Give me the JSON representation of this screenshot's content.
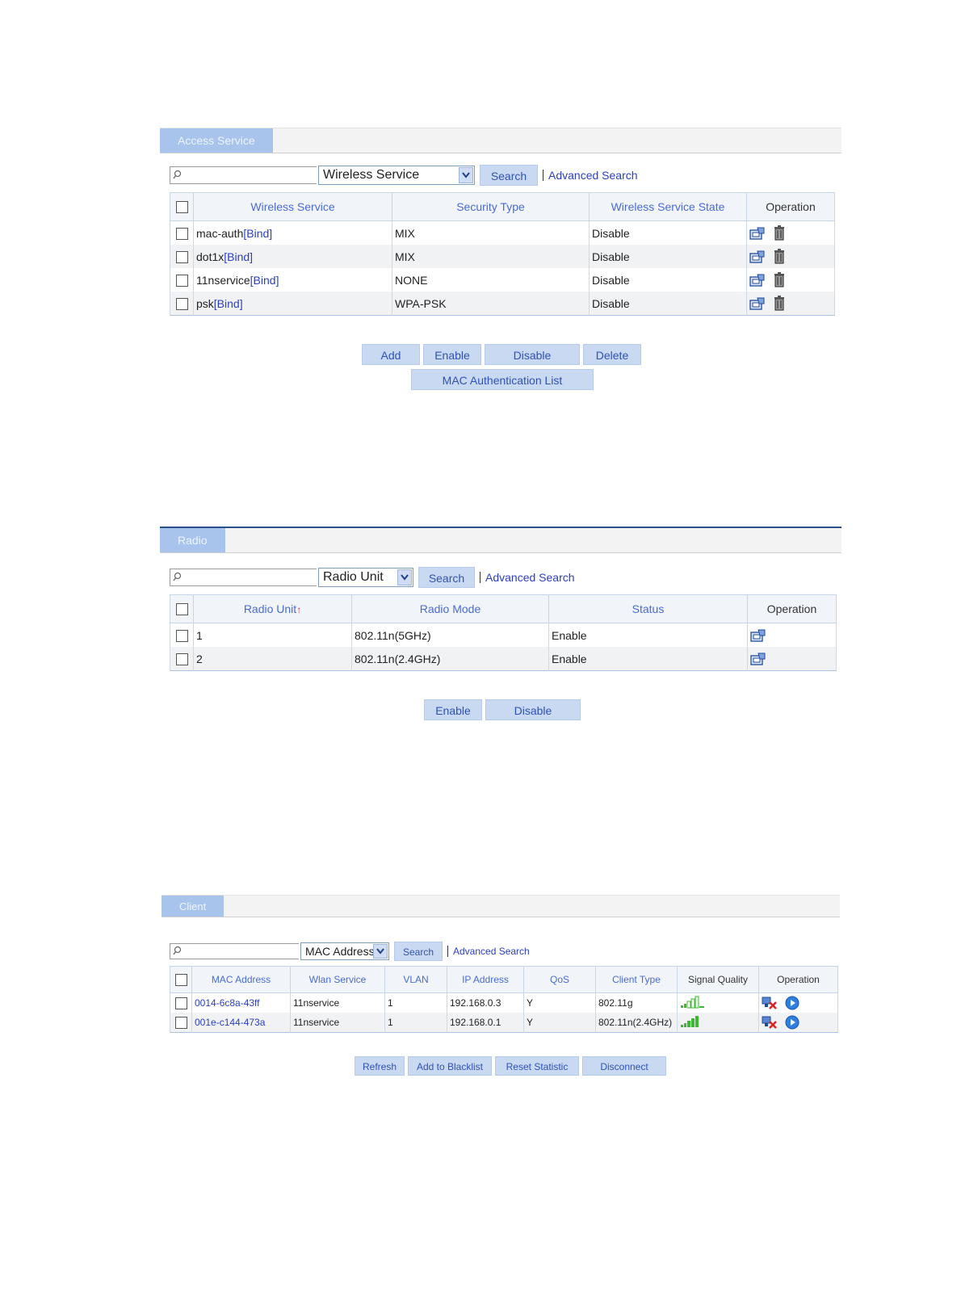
{
  "access_service": {
    "tab_label": "Access Service",
    "search": {
      "value": "",
      "field_select": "Wireless Service",
      "search_label": "Search",
      "advanced_label": "Advanced Search"
    },
    "columns": [
      "Wireless Service",
      "Security Type",
      "Wireless Service State",
      "Operation"
    ],
    "bind_text": "[Bind]",
    "rows": [
      {
        "name": "mac-auth",
        "security": "MIX",
        "state": "Disable"
      },
      {
        "name": "dot1x",
        "security": "MIX",
        "state": "Disable"
      },
      {
        "name": "11nservice",
        "security": "NONE",
        "state": "Disable"
      },
      {
        "name": "psk",
        "security": "WPA-PSK",
        "state": "Disable"
      }
    ],
    "buttons": {
      "add": "Add",
      "enable": "Enable",
      "disable": "Disable",
      "delete": "Delete",
      "mac_auth_list": "MAC Authentication List"
    }
  },
  "radio": {
    "tab_label": "Radio",
    "search": {
      "value": "",
      "field_select": "Radio Unit",
      "search_label": "Search",
      "advanced_label": "Advanced Search"
    },
    "columns": [
      "Radio Unit",
      "Radio Mode",
      "Status",
      "Operation"
    ],
    "sort_arrow": "↑",
    "rows": [
      {
        "unit": "1",
        "mode": "802.11n(5GHz)",
        "status": "Enable"
      },
      {
        "unit": "2",
        "mode": "802.11n(2.4GHz)",
        "status": "Enable"
      }
    ],
    "buttons": {
      "enable": "Enable",
      "disable": "Disable"
    }
  },
  "client": {
    "tab_label": "Client",
    "search": {
      "value": "",
      "field_select": "MAC Address",
      "search_label": "Search",
      "advanced_label": "Advanced Search"
    },
    "columns": [
      "MAC Address",
      "Wlan Service",
      "VLAN",
      "IP Address",
      "QoS",
      "Client Type",
      "Signal Quality",
      "Operation"
    ],
    "rows": [
      {
        "mac": "0014-6c8a-43ff",
        "wlan": "11nservice",
        "vlan": "1",
        "ip": "192.168.0.3",
        "qos": "Y",
        "type": "802.11g",
        "signal_bars": 3
      },
      {
        "mac": "001e-c144-473a",
        "wlan": "11nservice",
        "vlan": "1",
        "ip": "192.168.0.1",
        "qos": "Y",
        "type": "802.11n(2.4GHz)",
        "signal_bars": 5
      }
    ],
    "buttons": {
      "refresh": "Refresh",
      "blacklist": "Add to Blacklist",
      "reset": "Reset Statistic",
      "disconnect": "Disconnect"
    }
  }
}
